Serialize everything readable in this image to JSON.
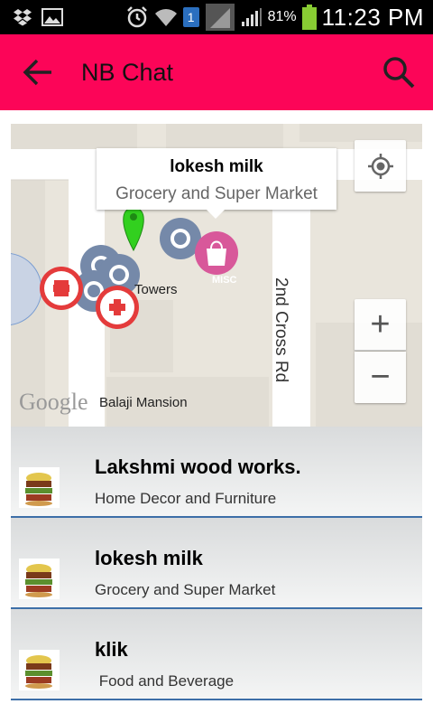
{
  "status_bar": {
    "battery_percent": "81%",
    "time": "11:23 PM",
    "sim_number": "1",
    "icons": [
      "dropbox-icon",
      "image-icon",
      "alarm-icon",
      "wifi-icon",
      "sim-icon",
      "signal-icon",
      "signal-icon",
      "battery-icon"
    ]
  },
  "app_bar": {
    "title": "NB Chat",
    "back_icon": "arrow-back-icon",
    "search_icon": "search-icon",
    "color": "#fc0558"
  },
  "map": {
    "info_window": {
      "title": "lokesh milk",
      "subtitle": "Grocery and Super Market"
    },
    "labels": {
      "towers": "Towers",
      "road": "2nd Cross Rd",
      "building": "Balaji Mansion",
      "misc": "MISC",
      "google": "Google"
    },
    "controls": {
      "locate": "my-location-icon",
      "zoom_in": "+",
      "zoom_out": "−"
    }
  },
  "list": {
    "items": [
      {
        "title": "Lakshmi wood works.",
        "subtitle": "Home Decor and Furniture"
      },
      {
        "title": "lokesh milk",
        "subtitle": "Grocery and Super Market"
      },
      {
        "title": "klik",
        "subtitle": " Food and Beverage"
      }
    ]
  }
}
